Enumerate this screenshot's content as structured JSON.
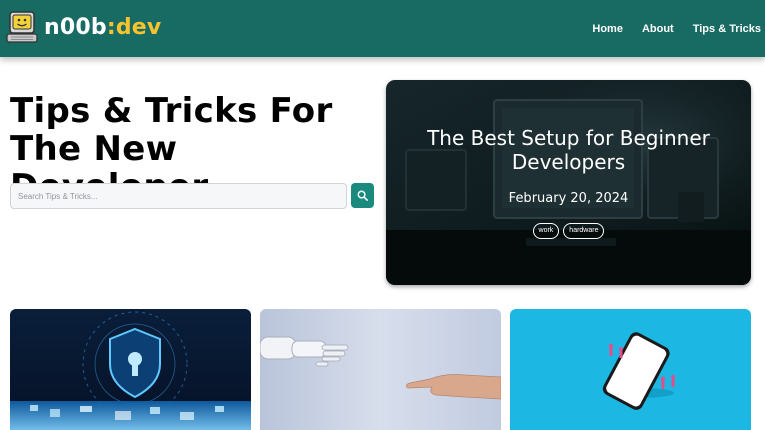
{
  "nav": {
    "brand_main": "n00b",
    "brand_accent": ":dev",
    "links": [
      "Home",
      "About",
      "Tips & Tricks"
    ]
  },
  "hero": {
    "title_line1": "Tips & Tricks For",
    "title_line2": "The New Developer",
    "search_placeholder": "Search Tips & Tricks..."
  },
  "featured": {
    "title_line1": "The Best Setup for Beginner",
    "title_line2": "Developers",
    "date": "February 20, 2024",
    "tags": [
      "work",
      "hardware"
    ]
  },
  "icons": {
    "logo": "retro-computer-smiley-icon",
    "search": "search-icon"
  },
  "colors": {
    "navbar": "#176b62",
    "brand_accent": "#f6c32f",
    "search_button": "#1a8a7e"
  }
}
